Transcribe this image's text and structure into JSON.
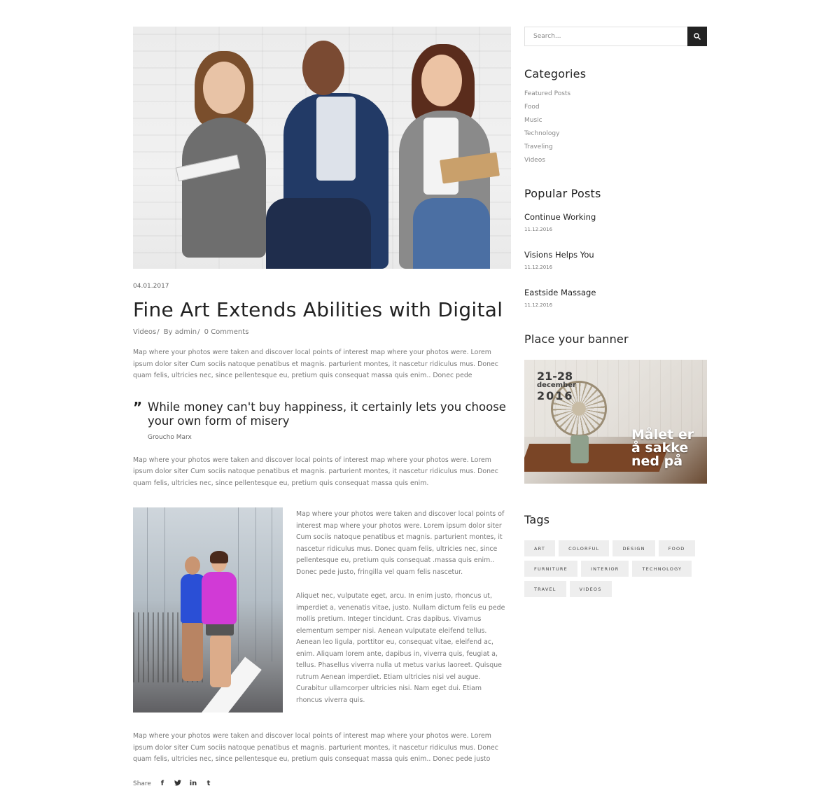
{
  "post": {
    "date": "04.01.2017",
    "title": "Fine Art Extends Abilities with Digital",
    "meta": {
      "category": "Videos",
      "author": "By admin",
      "comments": "0 Comments"
    },
    "paragraph_1": "Map where your photos were taken and discover local points of interest map where your photos were. Lorem ipsum dolor siter Cum sociis natoque penatibus et magnis. parturient montes, it nascetur ridiculus mus. Donec quam felis, ultricies nec, since pellentesque eu, pretium quis consequat massa quis enim.. Donec pede",
    "quote": {
      "text": "While money can't buy happiness, it certainly lets you choose your own form of misery",
      "author": "Groucho Marx"
    },
    "paragraph_2": "Map where your photos were taken and discover local points of interest map where your photos were. Lorem ipsum dolor siter Cum sociis natoque penatibus et magnis. parturient montes, it nascetur ridiculus mus. Donec quam felis, ultricies nec, since pellentesque eu, pretium quis consequat massa quis enim.",
    "col_paragraph_1": "Map where your photos were taken and discover local points of interest map where your photos were. Lorem ipsum dolor siter Cum sociis natoque penatibus et magnis. parturient montes, it nascetur ridiculus mus. Donec quam felis, ultricies nec, since pellentesque eu, pretium quis consequat .massa quis enim.. Donec pede justo, fringilla vel quam felis nascetur.",
    "col_paragraph_2": "Aliquet nec, vulputate eget, arcu. In enim justo, rhoncus ut, imperdiet a, venenatis vitae, justo. Nullam dictum felis eu pede mollis pretium. Integer tincidunt. Cras dapibus. Vivamus elementum semper nisi. Aenean vulputate eleifend tellus. Aenean leo ligula, porttitor eu, consequat vitae, eleifend ac, enim. Aliquam lorem ante, dapibus in, viverra quis, feugiat a, tellus. Phasellus viverra nulla ut metus varius laoreet. Quisque rutrum Aenean imperdiet. Etiam ultricies nisi vel augue. Curabitur ullamcorper ultricies nisi. Nam eget dui. Etiam rhoncus viverra quis.",
    "paragraph_3": "Map where your photos were taken and discover local points of interest map where your photos were. Lorem ipsum dolor siter Cum sociis natoque penatibus et magnis. parturient montes, it nascetur ridiculus mus. Donec quam felis, ultricies nec, since pellentesque eu, pretium quis consequat massa quis enim.. Donec pede justo",
    "share": {
      "label": "Share",
      "icons": [
        "facebook-icon",
        "twitter-icon",
        "linkedin-icon",
        "tumblr-icon"
      ]
    }
  },
  "sidebar": {
    "search": {
      "placeholder": "Search..."
    },
    "categories": {
      "title": "Categories",
      "items": [
        "Featured Posts",
        "Food",
        "Music",
        "Technology",
        "Traveling",
        "Videos"
      ]
    },
    "popular": {
      "title": "Popular Posts",
      "items": [
        {
          "title": "Continue Working",
          "date": "11.12.2016"
        },
        {
          "title": "Visions Helps You",
          "date": "11.12.2016"
        },
        {
          "title": "Eastside Massage",
          "date": "11.12.2016"
        }
      ]
    },
    "banner": {
      "title": "Place your banner",
      "dates_line1": "21-28",
      "dates_line2": "december",
      "dates_line3": "2016",
      "slogan_line1": "Målet er",
      "slogan_line2": "å sakke",
      "slogan_line3": "ned på"
    },
    "tags": {
      "title": "Tags",
      "items": [
        "ART",
        "COLORFUL",
        "DESIGN",
        "FOOD",
        "FURNITURE",
        "INTERIOR",
        "TECHNOLOGY",
        "TRAVEL",
        "VIDEOS"
      ]
    }
  },
  "colors": {
    "heading": "#222222",
    "body_text": "#777777",
    "search_button": "#222222",
    "tag_background": "#eeeeee"
  }
}
